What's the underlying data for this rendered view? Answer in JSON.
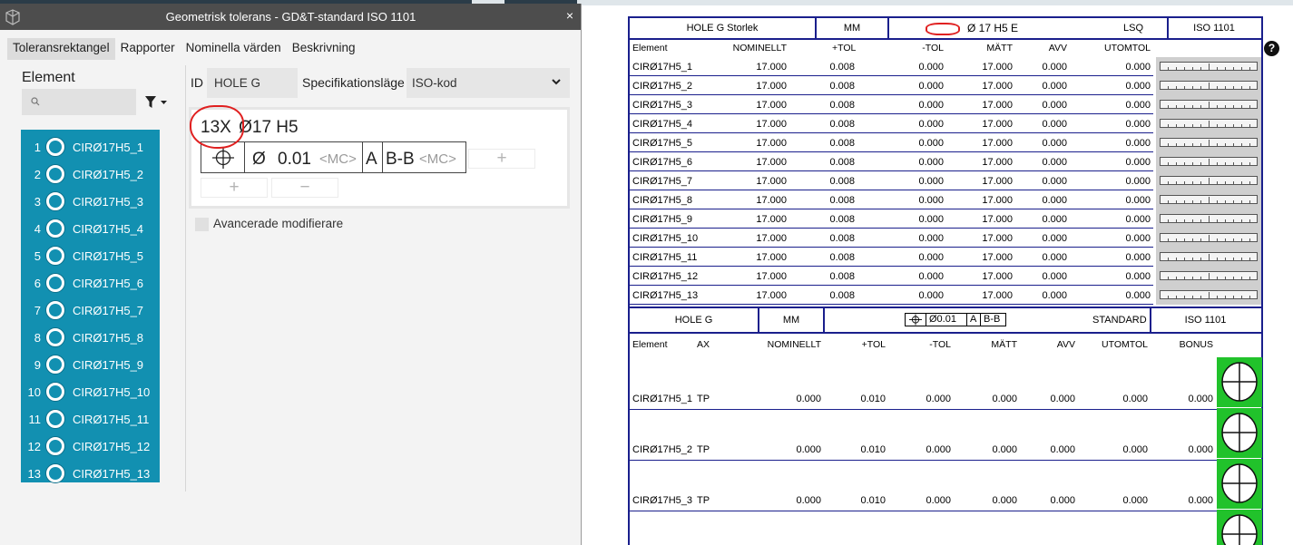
{
  "dialog": {
    "title": "Geometrisk tolerans - GD&T-standard ISO 1101",
    "close": "×",
    "tabs": [
      "Toleransrektangel",
      "Rapporter",
      "Nominella värden",
      "Beskrivning"
    ],
    "help": "?",
    "element_label": "Element",
    "elements": [
      {
        "num": "1",
        "name": "CIRØ17H5_1"
      },
      {
        "num": "2",
        "name": "CIRØ17H5_2"
      },
      {
        "num": "3",
        "name": "CIRØ17H5_3"
      },
      {
        "num": "4",
        "name": "CIRØ17H5_4"
      },
      {
        "num": "5",
        "name": "CIRØ17H5_5"
      },
      {
        "num": "6",
        "name": "CIRØ17H5_6"
      },
      {
        "num": "7",
        "name": "CIRØ17H5_7"
      },
      {
        "num": "8",
        "name": "CIRØ17H5_8"
      },
      {
        "num": "9",
        "name": "CIRØ17H5_9"
      },
      {
        "num": "10",
        "name": "CIRØ17H5_10"
      },
      {
        "num": "11",
        "name": "CIRØ17H5_11"
      },
      {
        "num": "12",
        "name": "CIRØ17H5_12"
      },
      {
        "num": "13",
        "name": "CIRØ17H5_13"
      }
    ],
    "id_label": "ID",
    "id_value": "HOLE G",
    "spec_label": "Specifikationsläge",
    "spec_value": "ISO-kod",
    "quantity": "13X",
    "size": "Ø17  H5",
    "fcf": {
      "dia": "Ø",
      "tol": "0.01",
      "mc1": "<MC>",
      "datum_a": "A",
      "datum_bb": "B-B",
      "mc2": "<MC>"
    },
    "plus": "+",
    "minus": "−",
    "advanced": "Avancerade modifierare"
  },
  "report": {
    "size_header": {
      "name": "HOLE G Storlek",
      "unit": "MM",
      "spec": "Ø  17  H5  E",
      "method": "LSQ",
      "standard": "ISO 1101"
    },
    "size_columns": [
      "Element",
      "NOMINELLT",
      "+TOL",
      "-TOL",
      "MÄTT",
      "AVV",
      "UTOMTOL"
    ],
    "size_rows": [
      [
        "CIRØ17H5_1",
        "17.000",
        "0.008",
        "0.000",
        "17.000",
        "0.000",
        "0.000"
      ],
      [
        "CIRØ17H5_2",
        "17.000",
        "0.008",
        "0.000",
        "17.000",
        "0.000",
        "0.000"
      ],
      [
        "CIRØ17H5_3",
        "17.000",
        "0.008",
        "0.000",
        "17.000",
        "0.000",
        "0.000"
      ],
      [
        "CIRØ17H5_4",
        "17.000",
        "0.008",
        "0.000",
        "17.000",
        "0.000",
        "0.000"
      ],
      [
        "CIRØ17H5_5",
        "17.000",
        "0.008",
        "0.000",
        "17.000",
        "0.000",
        "0.000"
      ],
      [
        "CIRØ17H5_6",
        "17.000",
        "0.008",
        "0.000",
        "17.000",
        "0.000",
        "0.000"
      ],
      [
        "CIRØ17H5_7",
        "17.000",
        "0.008",
        "0.000",
        "17.000",
        "0.000",
        "0.000"
      ],
      [
        "CIRØ17H5_8",
        "17.000",
        "0.008",
        "0.000",
        "17.000",
        "0.000",
        "0.000"
      ],
      [
        "CIRØ17H5_9",
        "17.000",
        "0.008",
        "0.000",
        "17.000",
        "0.000",
        "0.000"
      ],
      [
        "CIRØ17H5_10",
        "17.000",
        "0.008",
        "0.000",
        "17.000",
        "0.000",
        "0.000"
      ],
      [
        "CIRØ17H5_11",
        "17.000",
        "0.008",
        "0.000",
        "17.000",
        "0.000",
        "0.000"
      ],
      [
        "CIRØ17H5_12",
        "17.000",
        "0.008",
        "0.000",
        "17.000",
        "0.000",
        "0.000"
      ],
      [
        "CIRØ17H5_13",
        "17.000",
        "0.008",
        "0.000",
        "17.000",
        "0.000",
        "0.000"
      ]
    ],
    "pos_header": {
      "name": "HOLE G",
      "unit": "MM",
      "fcf": {
        "dia_tol": "Ø0.01",
        "a": "A",
        "bb": "B-B"
      },
      "standard_label": "STANDARD",
      "standard": "ISO 1101"
    },
    "pos_columns": [
      "Element",
      "AX",
      "NOMINELLT",
      "+TOL",
      "-TOL",
      "MÄTT",
      "AVV",
      "UTOMTOL",
      "BONUS"
    ],
    "pos_rows": [
      [
        "CIRØ17H5_1",
        "TP",
        "0.000",
        "0.010",
        "0.000",
        "0.000",
        "0.000",
        "0.000",
        "0.000"
      ],
      [
        "CIRØ17H5_2",
        "TP",
        "0.000",
        "0.010",
        "0.000",
        "0.000",
        "0.000",
        "0.000",
        "0.000"
      ],
      [
        "CIRØ17H5_3",
        "TP",
        "0.000",
        "0.010",
        "0.000",
        "0.000",
        "0.000",
        "0.000",
        "0.000"
      ]
    ]
  },
  "colors": {
    "accent": "#1290b1",
    "report_border": "#1a1f8c",
    "pass_green": "#21c22b",
    "annotation": "#e02020"
  }
}
